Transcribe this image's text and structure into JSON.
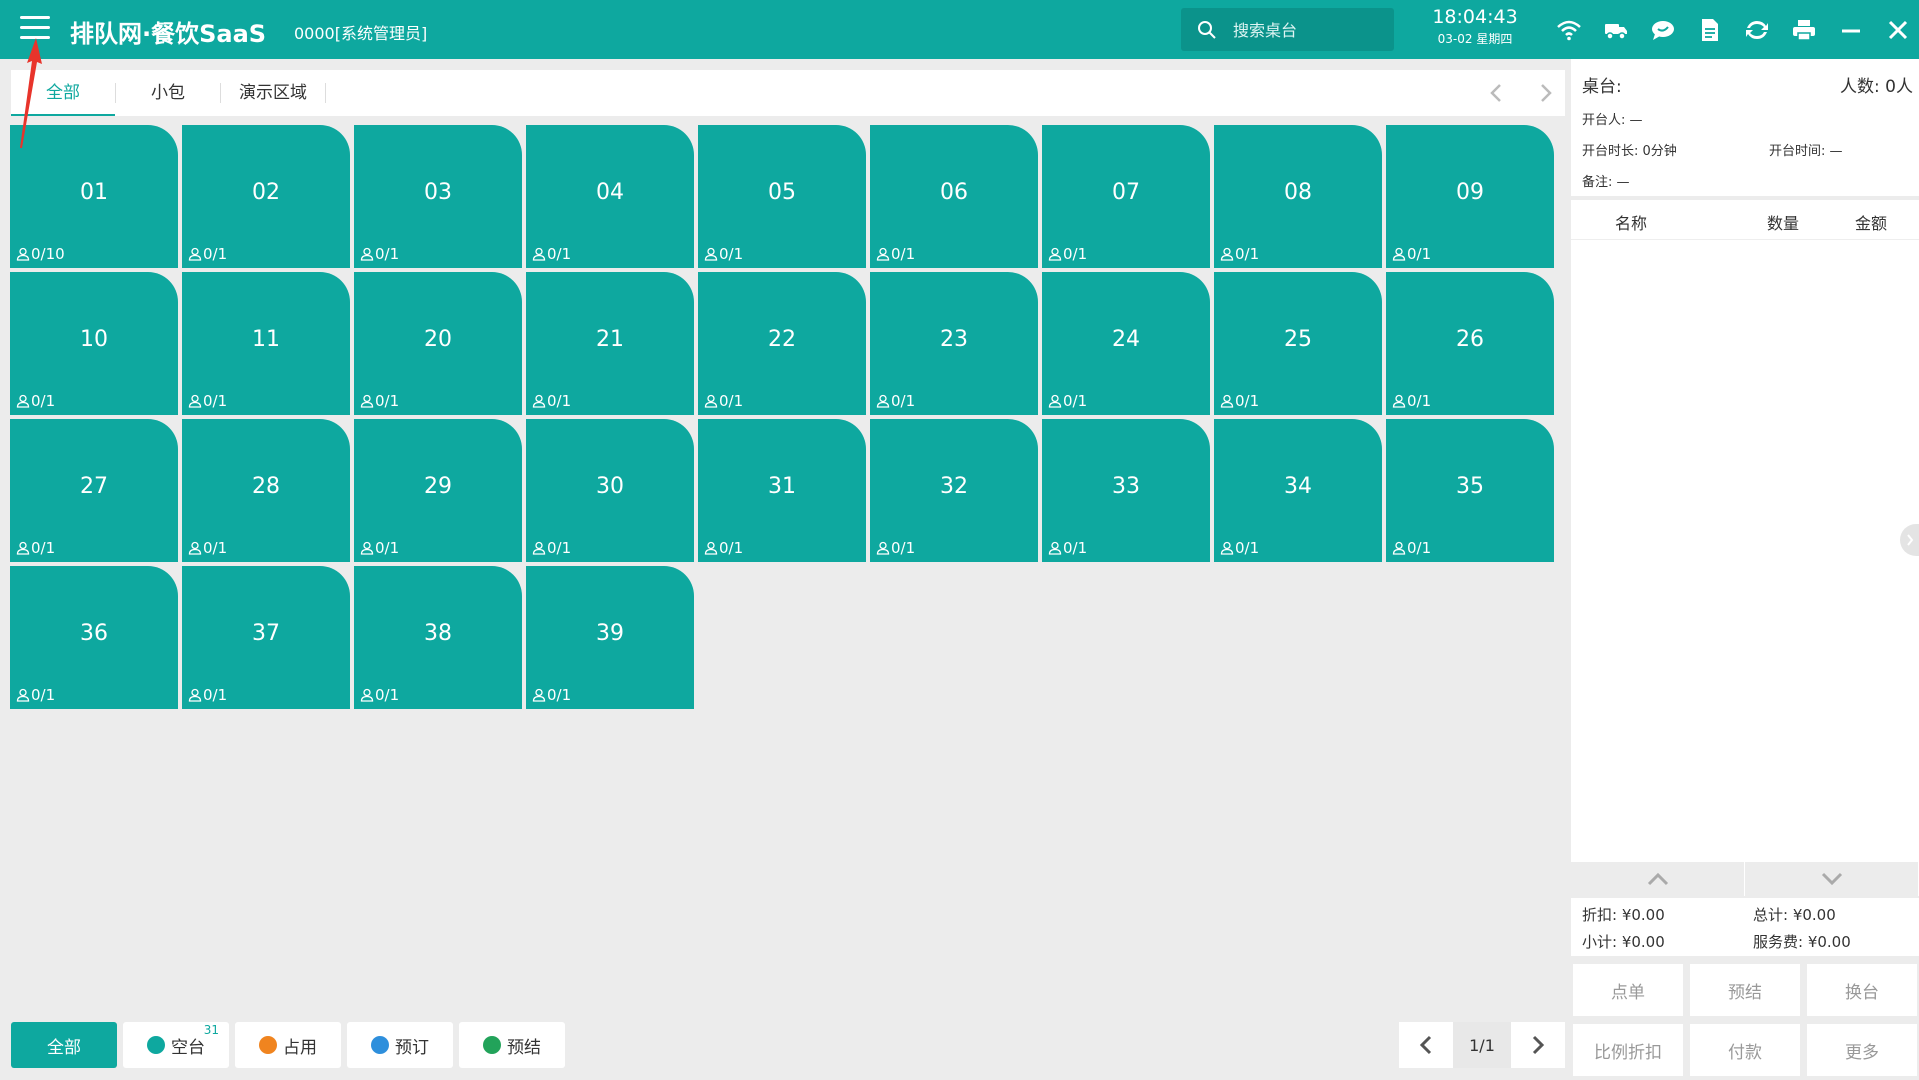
{
  "header": {
    "logo": "排队网·餐饮SaaS",
    "user": "0000[系统管理员]",
    "search_placeholder": "搜索桌台",
    "time": "18:04:43",
    "date": "03-02 星期四",
    "icons": [
      "wifi-icon",
      "delivery-icon",
      "chat-icon",
      "document-icon",
      "sync-icon",
      "printer-icon",
      "minimize-icon",
      "close-icon"
    ]
  },
  "area_tabs": [
    {
      "label": "全部",
      "active": true
    },
    {
      "label": "小包",
      "active": false
    },
    {
      "label": "演示区域",
      "active": false
    }
  ],
  "tables": [
    {
      "number": "01",
      "seats": "0/10"
    },
    {
      "number": "02",
      "seats": "0/1"
    },
    {
      "number": "03",
      "seats": "0/1"
    },
    {
      "number": "04",
      "seats": "0/1"
    },
    {
      "number": "05",
      "seats": "0/1"
    },
    {
      "number": "06",
      "seats": "0/1"
    },
    {
      "number": "07",
      "seats": "0/1"
    },
    {
      "number": "08",
      "seats": "0/1"
    },
    {
      "number": "09",
      "seats": "0/1"
    },
    {
      "number": "10",
      "seats": "0/1"
    },
    {
      "number": "11",
      "seats": "0/1"
    },
    {
      "number": "20",
      "seats": "0/1"
    },
    {
      "number": "21",
      "seats": "0/1"
    },
    {
      "number": "22",
      "seats": "0/1"
    },
    {
      "number": "23",
      "seats": "0/1"
    },
    {
      "number": "24",
      "seats": "0/1"
    },
    {
      "number": "25",
      "seats": "0/1"
    },
    {
      "number": "26",
      "seats": "0/1"
    },
    {
      "number": "27",
      "seats": "0/1"
    },
    {
      "number": "28",
      "seats": "0/1"
    },
    {
      "number": "29",
      "seats": "0/1"
    },
    {
      "number": "30",
      "seats": "0/1"
    },
    {
      "number": "31",
      "seats": "0/1"
    },
    {
      "number": "32",
      "seats": "0/1"
    },
    {
      "number": "33",
      "seats": "0/1"
    },
    {
      "number": "34",
      "seats": "0/1"
    },
    {
      "number": "35",
      "seats": "0/1"
    },
    {
      "number": "36",
      "seats": "0/1"
    },
    {
      "number": "37",
      "seats": "0/1"
    },
    {
      "number": "38",
      "seats": "0/1"
    },
    {
      "number": "39",
      "seats": "0/1"
    }
  ],
  "status_filters": [
    {
      "label": "全部",
      "color": "",
      "count": ""
    },
    {
      "label": "空台",
      "color": "#0ea89f",
      "count": "31"
    },
    {
      "label": "占用",
      "color": "#f0841f",
      "count": ""
    },
    {
      "label": "预订",
      "color": "#2e8fdc",
      "count": ""
    },
    {
      "label": "预结",
      "color": "#22a35a",
      "count": ""
    }
  ],
  "pager": {
    "page": "1/1"
  },
  "panel": {
    "table_label": "桌台:",
    "people": "人数: 0人",
    "opener": "开台人: —",
    "duration": "开台时长: 0分钟",
    "open_time": "开台时间: —",
    "remark": "备注: —",
    "col_name": "名称",
    "col_qty": "数量",
    "col_amount": "金额",
    "discount": "折扣: ¥0.00",
    "total": "总计: ¥0.00",
    "subtotal": "小计: ¥0.00",
    "service_fee": "服务费: ¥0.00",
    "actions": [
      "点单",
      "预结",
      "换台",
      "比例折扣",
      "付款",
      "更多"
    ]
  },
  "colors": {
    "accent": "#0ea89f",
    "accent_dark": "#0b938b",
    "background": "#ececec"
  }
}
